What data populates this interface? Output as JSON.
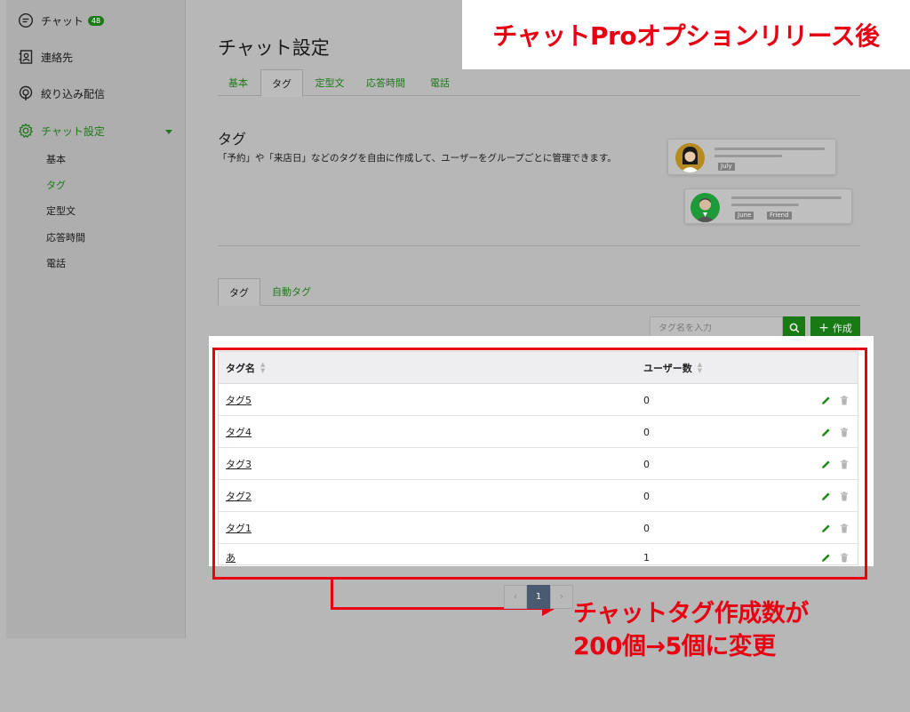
{
  "sidebar": {
    "items": [
      {
        "label": "チャット",
        "badge": "48",
        "icon": "chat-bubble-icon"
      },
      {
        "label": "連絡先",
        "icon": "contacts-icon"
      },
      {
        "label": "絞り込み配信",
        "icon": "broadcast-icon"
      },
      {
        "label": "チャット設定",
        "icon": "gear-icon"
      }
    ],
    "sub_items": [
      "基本",
      "タグ",
      "定型文",
      "応答時間",
      "電話"
    ]
  },
  "page": {
    "title": "チャット設定",
    "tabs": [
      "基本",
      "タグ",
      "定型文",
      "応答時間",
      "電話"
    ],
    "section_title": "タグ",
    "section_desc": "「予約」や「来店日」などのタグを自由に作成して、ユーザーをグループごとに管理できます。"
  },
  "illustration": {
    "card1_tag": "July",
    "card2_tags": [
      "June",
      "Friend"
    ]
  },
  "inner_tabs": [
    "タグ",
    "自動タグ"
  ],
  "search": {
    "placeholder": "タグ名を入力"
  },
  "create_button": "作成",
  "table": {
    "headers": [
      "タグ名",
      "ユーザー数"
    ],
    "rows": [
      {
        "name": "タグ5",
        "count": "0"
      },
      {
        "name": "タグ4",
        "count": "0"
      },
      {
        "name": "タグ3",
        "count": "0"
      },
      {
        "name": "タグ2",
        "count": "0"
      },
      {
        "name": "タグ1",
        "count": "0"
      },
      {
        "name": "あ",
        "count": "1"
      }
    ]
  },
  "pagination": {
    "current": "1"
  },
  "annotations": {
    "top": "チャットProオプションリリース後",
    "bottom_line1": "チャットタグ作成数が",
    "bottom_line2": "200個→5個に変更"
  },
  "colors": {
    "accent": "#1d7a19",
    "annotation": "#e60012"
  }
}
